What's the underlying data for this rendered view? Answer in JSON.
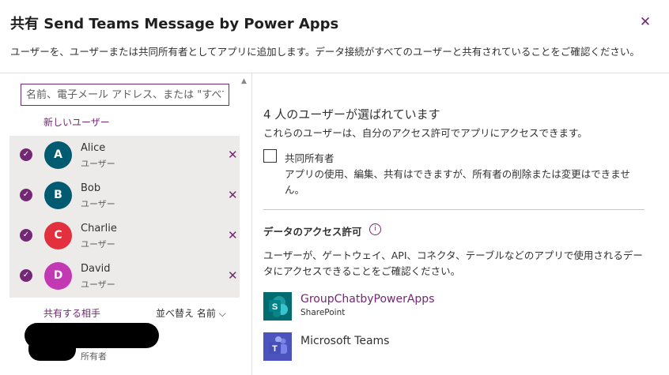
{
  "header": {
    "title": "共有 Send Teams Message by Power Apps",
    "subtitle": "ユーザーを、ユーザーまたは共同所有者としてアプリに追加します。データ接続がすべてのユーザーと共有されていることをご確認ください。",
    "close_icon": "close-icon"
  },
  "left_panel": {
    "search_placeholder": "名前、電子メール アドレス、または \"すべてのユーザー\" を入力します",
    "new_user_label": "新しいユーザー",
    "selected_users": [
      {
        "initial": "A",
        "name": "Alice",
        "role": "ユーザー",
        "color": "#005b70"
      },
      {
        "initial": "B",
        "name": "Bob",
        "role": "ユーザー",
        "color": "#005b70"
      },
      {
        "initial": "C",
        "name": "Charlie",
        "role": "ユーザー",
        "color": "#e3303f"
      },
      {
        "initial": "D",
        "name": "David",
        "role": "ユーザー",
        "color": "#c239b3"
      }
    ],
    "shared_with_label": "共有する相手",
    "sort_label": "並べ替え 名前",
    "owner_role": "所有者"
  },
  "right_panel": {
    "count_text": "4 人のユーザーが選ばれています",
    "count_desc": "これらのユーザーは、自分のアクセス許可でアプリにアクセスできます。",
    "co_owner_label": "共同所有者",
    "co_owner_desc": "アプリの使用、編集、共有はできますが、所有者の削除または変更はできません。",
    "data_permission_title": "データのアクセス許可",
    "data_permission_desc": "ユーザーが、ゲートウェイ、API、コネクタ、テーブルなどのアプリで使用されるデータにアクセスできることをご確認ください。",
    "data_sources": [
      {
        "name": "GroupChatbyPowerApps",
        "type": "SharePoint",
        "icon": "sharepoint-icon"
      },
      {
        "name": "Microsoft Teams",
        "type": "",
        "icon": "teams-icon"
      }
    ]
  },
  "colors": {
    "accent": "#742774"
  }
}
